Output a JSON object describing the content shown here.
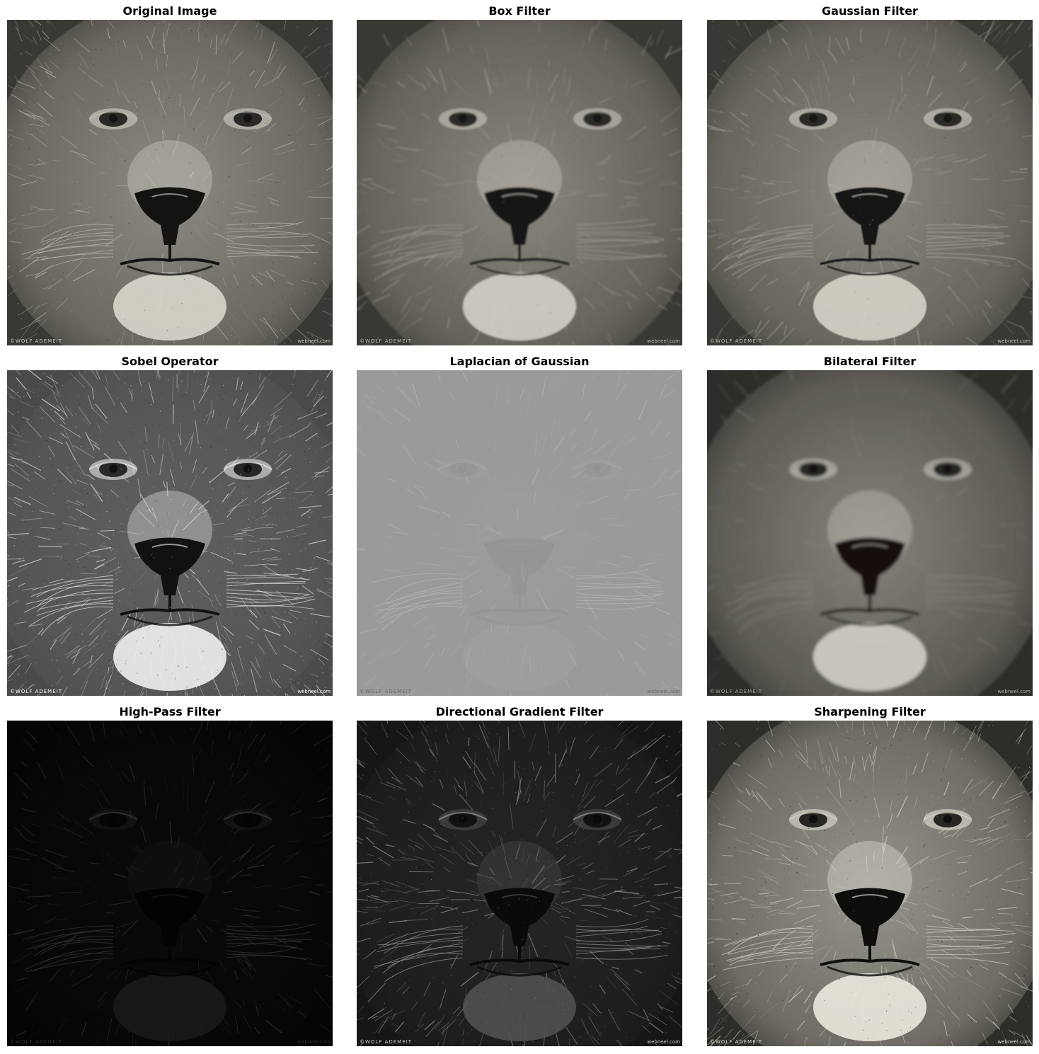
{
  "panels": [
    {
      "title": "Original Image",
      "style": "original"
    },
    {
      "title": "Box Filter",
      "style": "box"
    },
    {
      "title": "Gaussian Filter",
      "style": "gauss"
    },
    {
      "title": "Sobel Operator",
      "style": "sobel"
    },
    {
      "title": "Laplacian of Gaussian",
      "style": "log"
    },
    {
      "title": "Bilateral Filter",
      "style": "bilateral"
    },
    {
      "title": "High-Pass Filter",
      "style": "highpass"
    },
    {
      "title": "Directional Gradient Filter",
      "style": "directional"
    },
    {
      "title": "Sharpening Filter",
      "style": "sharpen"
    }
  ],
  "watermark": {
    "left": "©WOLF ADEMEIT",
    "right": "webneel.com"
  }
}
